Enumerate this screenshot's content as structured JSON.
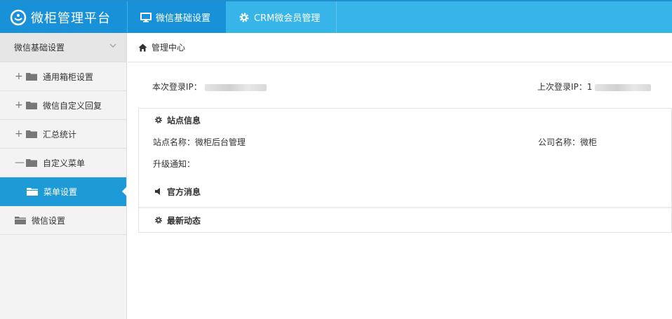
{
  "header": {
    "logo_text": "微柜管理平台",
    "tabs": [
      {
        "label": "微信基础设置",
        "icon": "monitor-icon"
      },
      {
        "label": "CRM微会员管理",
        "icon": "gear-icon"
      }
    ]
  },
  "sidebar": {
    "section_title": "微信基础设置",
    "items": [
      {
        "label": "通用箱柜设置",
        "expander": "+"
      },
      {
        "label": "微信自定义回复",
        "expander": "+"
      },
      {
        "label": "汇总统计",
        "expander": "+"
      },
      {
        "label": "自定义菜单",
        "expander": "—"
      },
      {
        "label": "菜单设置",
        "expander": ""
      },
      {
        "label": "微信设置",
        "expander": ""
      }
    ]
  },
  "breadcrumb": {
    "label": "管理中心"
  },
  "main": {
    "current_ip_label": "本次登录IP：",
    "last_ip_label": "上次登录IP：1",
    "site_info_title": "站点信息",
    "site_name": "站点名称：微柜后台管理",
    "company_name": "公司名称：微柜",
    "upgrade_notice": "升级通知：",
    "official_news_title": "官方消息",
    "latest_news_title": "最新动态"
  },
  "colors": {
    "accent": "#37b5e8",
    "accent_dark": "#1891d8",
    "sidebar_active": "#1e9ad6"
  }
}
